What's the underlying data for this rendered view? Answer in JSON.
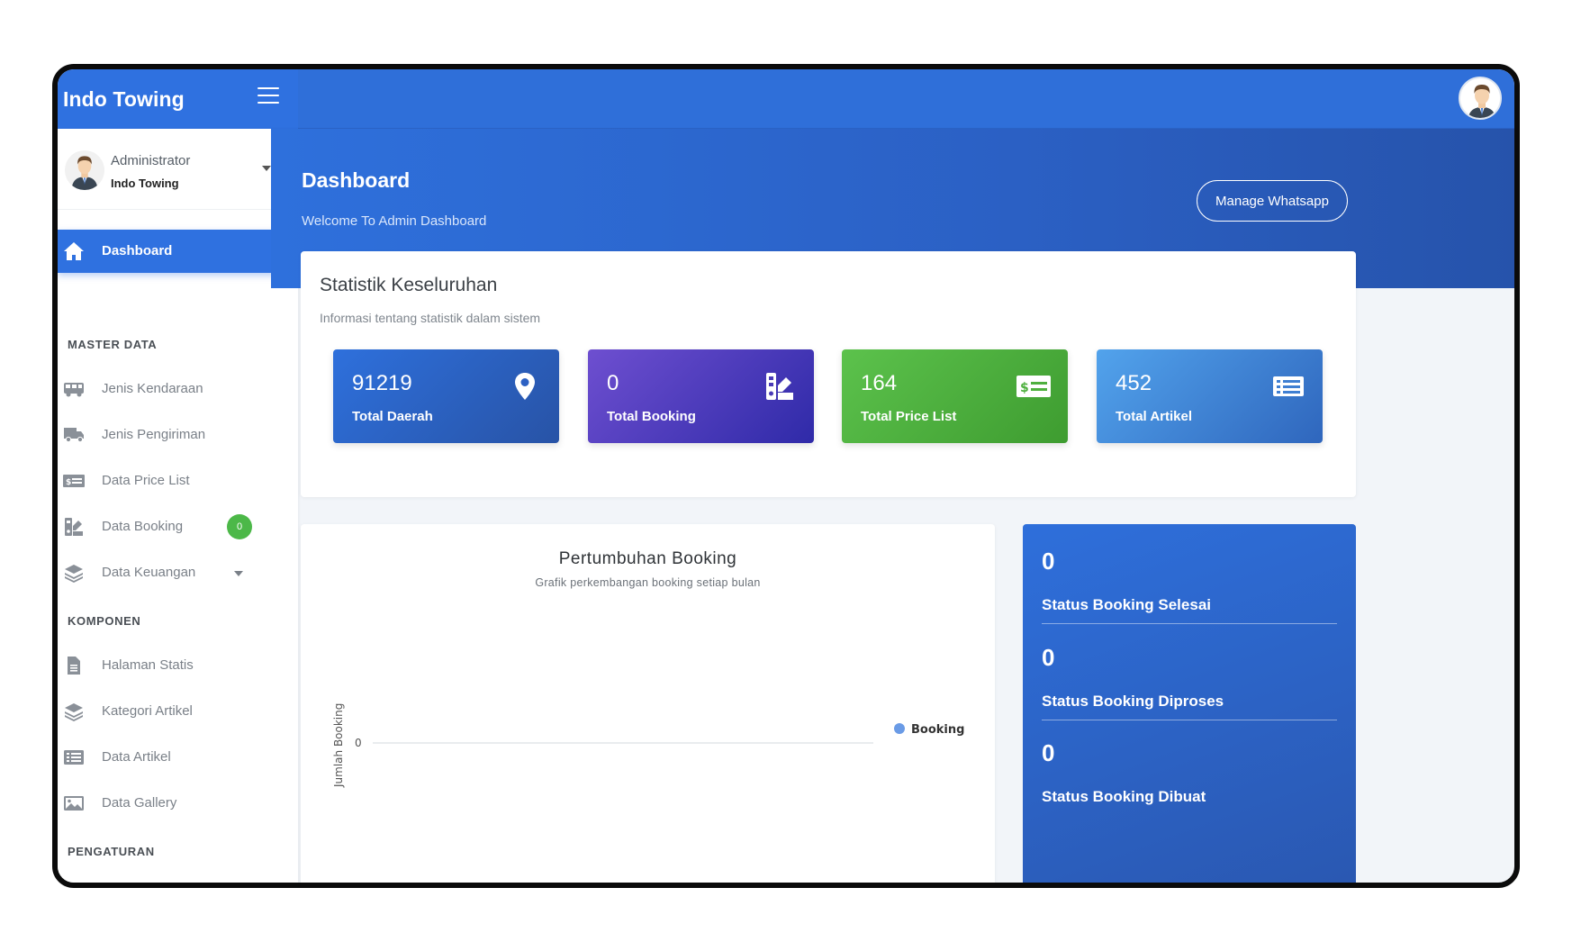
{
  "app": {
    "title": "Indo Towing"
  },
  "user": {
    "name": "Administrator",
    "org": "Indo Towing"
  },
  "sidebar": {
    "active": {
      "label": "Dashboard",
      "icon": "home-icon"
    },
    "sections": [
      {
        "label": "MASTER DATA",
        "items": [
          {
            "label": "Jenis Kendaraan",
            "icon": "bus-icon"
          },
          {
            "label": "Jenis Pengiriman",
            "icon": "truck-icon"
          },
          {
            "label": "Data Price List",
            "icon": "money-bill-icon"
          },
          {
            "label": "Data Booking",
            "icon": "swatchbook-icon",
            "badge": "0"
          },
          {
            "label": "Data Keuangan",
            "icon": "layers-icon"
          }
        ]
      },
      {
        "label": "KOMPONEN",
        "items": [
          {
            "label": "Halaman Statis",
            "icon": "file-icon"
          },
          {
            "label": "Kategori Artikel",
            "icon": "layers-icon"
          },
          {
            "label": "Data Artikel",
            "icon": "list-alt-icon"
          },
          {
            "label": "Data Gallery",
            "icon": "image-icon"
          }
        ]
      },
      {
        "label": "PENGATURAN"
      }
    ]
  },
  "header": {
    "title": "Dashboard",
    "subtitle": "Welcome To Admin Dashboard",
    "manage_button": "Manage Whatsapp"
  },
  "stats": {
    "title": "Statistik Keseluruhan",
    "subtitle": "Informasi tentang statistik dalam sistem",
    "tiles": [
      {
        "value": "91219",
        "label": "Total Daerah",
        "icon": "map-marker-icon"
      },
      {
        "value": "0",
        "label": "Total Booking",
        "icon": "swatchbook-icon"
      },
      {
        "value": "164",
        "label": "Total Price List",
        "icon": "money-bill-icon"
      },
      {
        "value": "452",
        "label": "Total Artikel",
        "icon": "list-alt-icon"
      }
    ]
  },
  "chart": {
    "title": "Pertumbuhan Booking",
    "subtitle": "Grafik perkembangan booking setiap bulan"
  },
  "chart_data": {
    "type": "line",
    "title": "Pertumbuhan Booking",
    "subtitle": "Grafik perkembangan booking setiap bulan",
    "ylabel": "Jumlah Booking",
    "xlabel": "",
    "y_ticks": [
      "0"
    ],
    "series": [
      {
        "name": "Booking",
        "values": [],
        "color": "#6a9be6"
      }
    ],
    "legend": "right"
  },
  "status": [
    {
      "value": "0",
      "label": "Status Booking Selesai"
    },
    {
      "value": "0",
      "label": "Status Booking Diproses"
    },
    {
      "value": "0",
      "label": "Status Booking Dibuat"
    }
  ],
  "colors": {
    "primary": "#2f71e0",
    "tile_blue": "#2e70dc",
    "tile_purple": "#5a3ec6",
    "tile_green": "#4fb03f",
    "tile_lightblue": "#4a8fe0",
    "badge_green": "#4cb848"
  }
}
